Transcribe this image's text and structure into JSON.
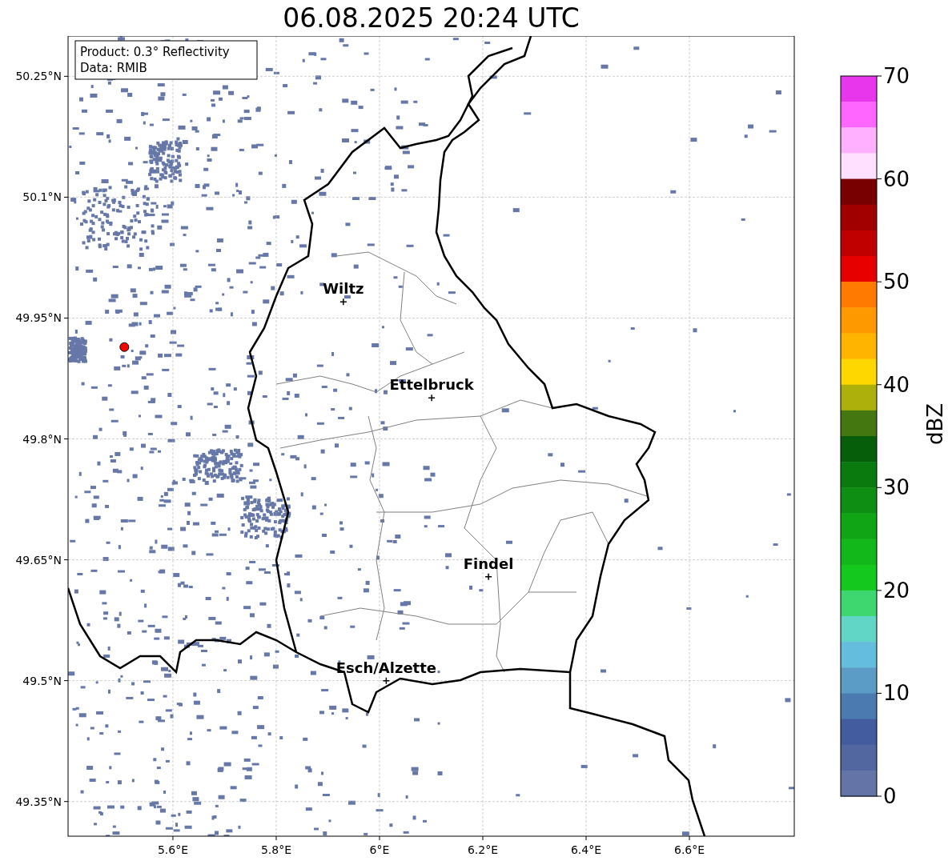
{
  "title": "06.08.2025 20:24 UTC",
  "info": [
    "Product: 0.3° Reflectivity",
    "Data: RMIB"
  ],
  "map": {
    "xticks": [
      "5.6°E",
      "5.8°E",
      "6°E",
      "6.2°E",
      "6.4°E",
      "6.6°E"
    ],
    "yticks": [
      "50.25°N",
      "50.1°N",
      "49.95°N",
      "49.8°N",
      "49.65°N",
      "49.5°N",
      "49.35°N"
    ],
    "radar": {
      "color": "#ff0000"
    },
    "cities": [
      {
        "name": "Wiltz"
      },
      {
        "name": "Ettelbruck"
      },
      {
        "name": "Findel"
      },
      {
        "name": "Esch/Alzette"
      }
    ]
  },
  "colorbar": {
    "label": "dBZ",
    "ticks": [
      "70",
      "60",
      "50",
      "40",
      "30",
      "20",
      "10",
      "0"
    ],
    "segments": [
      {
        "color": "#e836ec"
      },
      {
        "color": "#ff66ff"
      },
      {
        "color": "#ffb0ff"
      },
      {
        "color": "#ffe0ff"
      },
      {
        "color": "#780000"
      },
      {
        "color": "#a00000"
      },
      {
        "color": "#c00000"
      },
      {
        "color": "#e60000"
      },
      {
        "color": "#ff7a00"
      },
      {
        "color": "#ff9900"
      },
      {
        "color": "#ffb400"
      },
      {
        "color": "#ffd700"
      },
      {
        "color": "#adb00a"
      },
      {
        "color": "#447710"
      },
      {
        "color": "#075e0a"
      },
      {
        "color": "#0a7a0e"
      },
      {
        "color": "#0e8e12"
      },
      {
        "color": "#10a514"
      },
      {
        "color": "#12b81a"
      },
      {
        "color": "#14c81e"
      },
      {
        "color": "#3ed66e"
      },
      {
        "color": "#62d6c6"
      },
      {
        "color": "#64bddc"
      },
      {
        "color": "#5a9cc6"
      },
      {
        "color": "#4a7ab0"
      },
      {
        "color": "#435ca0"
      },
      {
        "color": "#52679f"
      },
      {
        "color": "#6574a6"
      }
    ]
  }
}
